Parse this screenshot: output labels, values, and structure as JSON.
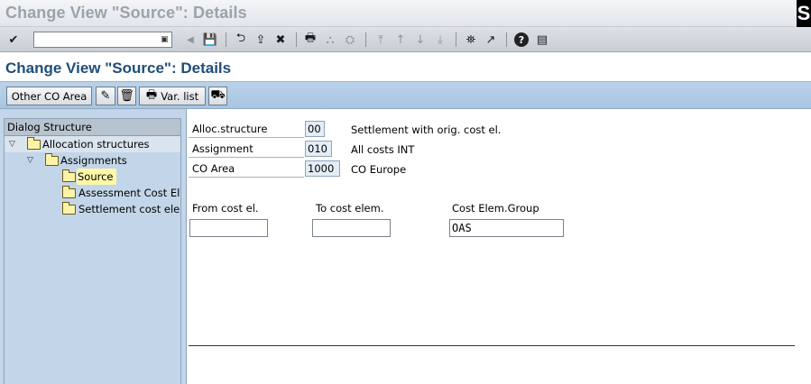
{
  "window": {
    "title": "Change View \"Source\": Details",
    "corner_glyph": "S"
  },
  "standard_toolbar": {
    "command_value": "",
    "dropdown_glyph": "▣",
    "icons": {
      "enter": "✔",
      "back_triangle": "◀",
      "save": "💾",
      "back": "⮌",
      "exit": "⇪",
      "cancel": "✖",
      "print": "🖶",
      "find": "⛬",
      "find_next": "⛭",
      "first_page": "⤒",
      "prev_page": "↑",
      "next_page": "↓",
      "last_page": "⤓",
      "new_session": "⛯",
      "shortcut": "↗",
      "help": "?",
      "layout": "▤"
    }
  },
  "page_header": {
    "title": "Change View \"Source\": Details"
  },
  "app_toolbar": {
    "other_co_area_label": "Other CO Area",
    "var_list_label": "Var. list",
    "icons": {
      "change_display": "✎",
      "delete": "🗑",
      "print": "🖶",
      "transport": "⛟"
    }
  },
  "dialog_structure": {
    "header": "Dialog Structure",
    "items": [
      {
        "label": "Allocation structures",
        "expanded": true,
        "level": 0
      },
      {
        "label": "Assignments",
        "expanded": true,
        "level": 1
      },
      {
        "label": "Source",
        "selected": true,
        "level": 2
      },
      {
        "label": "Assessment Cost Ele",
        "level": 2
      },
      {
        "label": "Settlement cost eler",
        "level": 2
      }
    ],
    "expand_glyph": "▽"
  },
  "header_fields": {
    "alloc_structure": {
      "label": "Alloc.structure",
      "value": "00",
      "description": "Settlement with orig. cost el."
    },
    "assignment": {
      "label": "Assignment",
      "value": "010",
      "description": "All costs INT"
    },
    "co_area": {
      "label": "CO Area",
      "value": "1000",
      "description": "CO Europe"
    }
  },
  "ranges": {
    "from_cost_el": {
      "label": "From cost el.",
      "value": ""
    },
    "to_cost_elem": {
      "label": "To cost elem.",
      "value": ""
    },
    "cost_elem_group": {
      "label": "Cost Elem.Group",
      "value": "OAS"
    }
  }
}
